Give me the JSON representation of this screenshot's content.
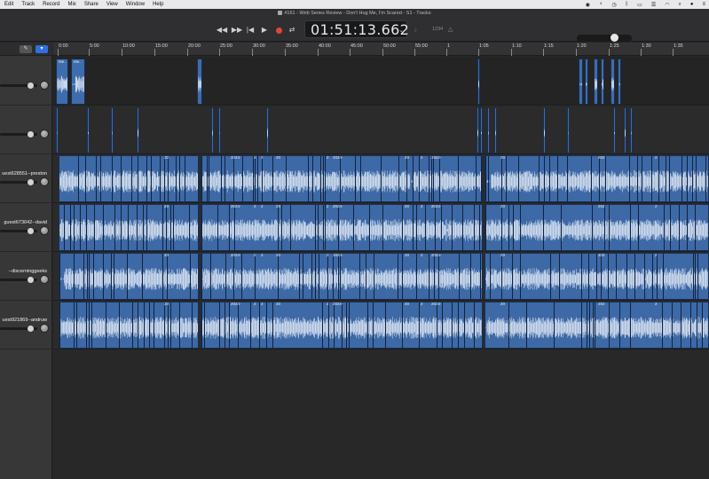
{
  "menubar": {
    "items": [
      "Edit",
      "Track",
      "Record",
      "Mix",
      "Share",
      "View",
      "Window",
      "Help"
    ],
    "status_icons": [
      "screen-record-icon",
      "microphone-icon",
      "clock-icon",
      "bluetooth-icon",
      "battery-icon",
      "control-center-icon",
      "wifi-icon",
      "search-icon",
      "user-icon",
      "menu-extras-icon"
    ]
  },
  "window": {
    "title": "#161 - Web Series Review - Don't Hug Me, I'm Scared - S1 - Tracks"
  },
  "transport": {
    "rewind": "◀◀",
    "forward": "▶▶",
    "to_start": "|◀",
    "play": "▶",
    "cycle": "⇄",
    "time": "01:51:13.662",
    "lcd_menu": "⌄",
    "tuner": "♪",
    "count_in": "1234",
    "metronome": "△"
  },
  "header_toolbar": {
    "pencil": "✎",
    "filter": "▾"
  },
  "tracks": [
    {
      "name": "",
      "type": "sparse"
    },
    {
      "name": "",
      "type": "sparse"
    },
    {
      "name": "uest628551--preston",
      "type": "dense"
    },
    {
      "name": "guest673042--david",
      "type": "dense"
    },
    {
      "name": "--discerninggeeks",
      "type": "dense"
    },
    {
      "name": "uest921869--andruw",
      "type": "dense"
    }
  ],
  "ruler": {
    "ticks": [
      "0:00",
      "5:00",
      "10:00",
      "15:00",
      "20:00",
      "25:00",
      "30:00",
      "35:00",
      "40:00",
      "45:00",
      "50:00",
      "55:00",
      "1",
      "1:05",
      "1:10",
      "1:15",
      "1:20",
      "1:25",
      "1:30",
      "1:35"
    ]
  },
  "region_labels": {
    "track1_a": "Me..",
    "track1_b": "Me..",
    "marker_20": "20",
    "marker_2024": "2024-",
    "marker_2": "2",
    "marker_202": "202"
  },
  "colors": {
    "region_blue": "#3d69a6",
    "record_red": "#e0443c",
    "accent_blue": "#2f6fe0"
  }
}
